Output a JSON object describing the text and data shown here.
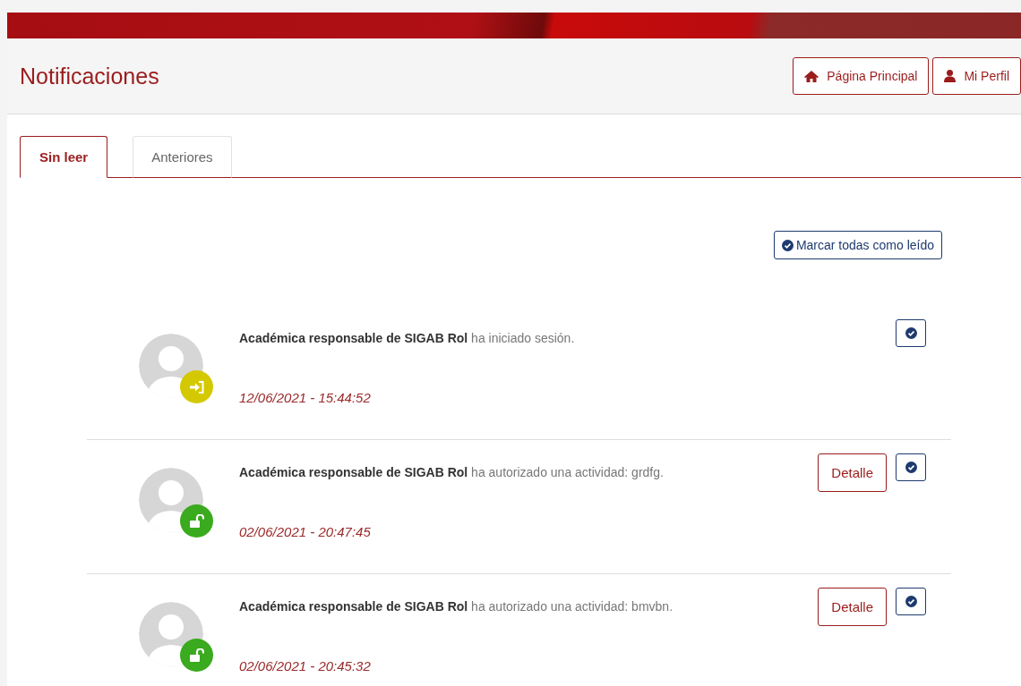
{
  "header": {
    "title": "Notificaciones",
    "buttons": [
      {
        "label": "Página Principal",
        "kind": "home"
      },
      {
        "label": "Mi Perfil",
        "kind": "user"
      }
    ]
  },
  "tabs": [
    {
      "label": "Sin leer",
      "selected": true
    },
    {
      "label": "Anteriores",
      "selected": false
    }
  ],
  "mark_all_button": "Marcar todas como leído",
  "notifications": [
    {
      "actor": "Académica responsable de SIGAB Rol",
      "action": "ha iniciado sesión.",
      "time": "12/06/2021 - 15:44:52",
      "kind": "login",
      "color": "#d4c900"
    },
    {
      "actor": "Académica responsable de SIGAB Rol",
      "action": "ha autorizado una actividad: grdfg.",
      "time": "02/06/2021 - 20:47:45",
      "kind": "unlock",
      "color": "#3aaa1e",
      "detail_button": "Detalle"
    },
    {
      "actor": "Académica responsable de SIGAB Rol",
      "action": "ha autorizado una actividad: bmvbn.",
      "time": "02/06/2021 - 20:45:32",
      "kind": "unlock",
      "color": "#3aaa1e",
      "detail_button": "Detalle"
    }
  ]
}
